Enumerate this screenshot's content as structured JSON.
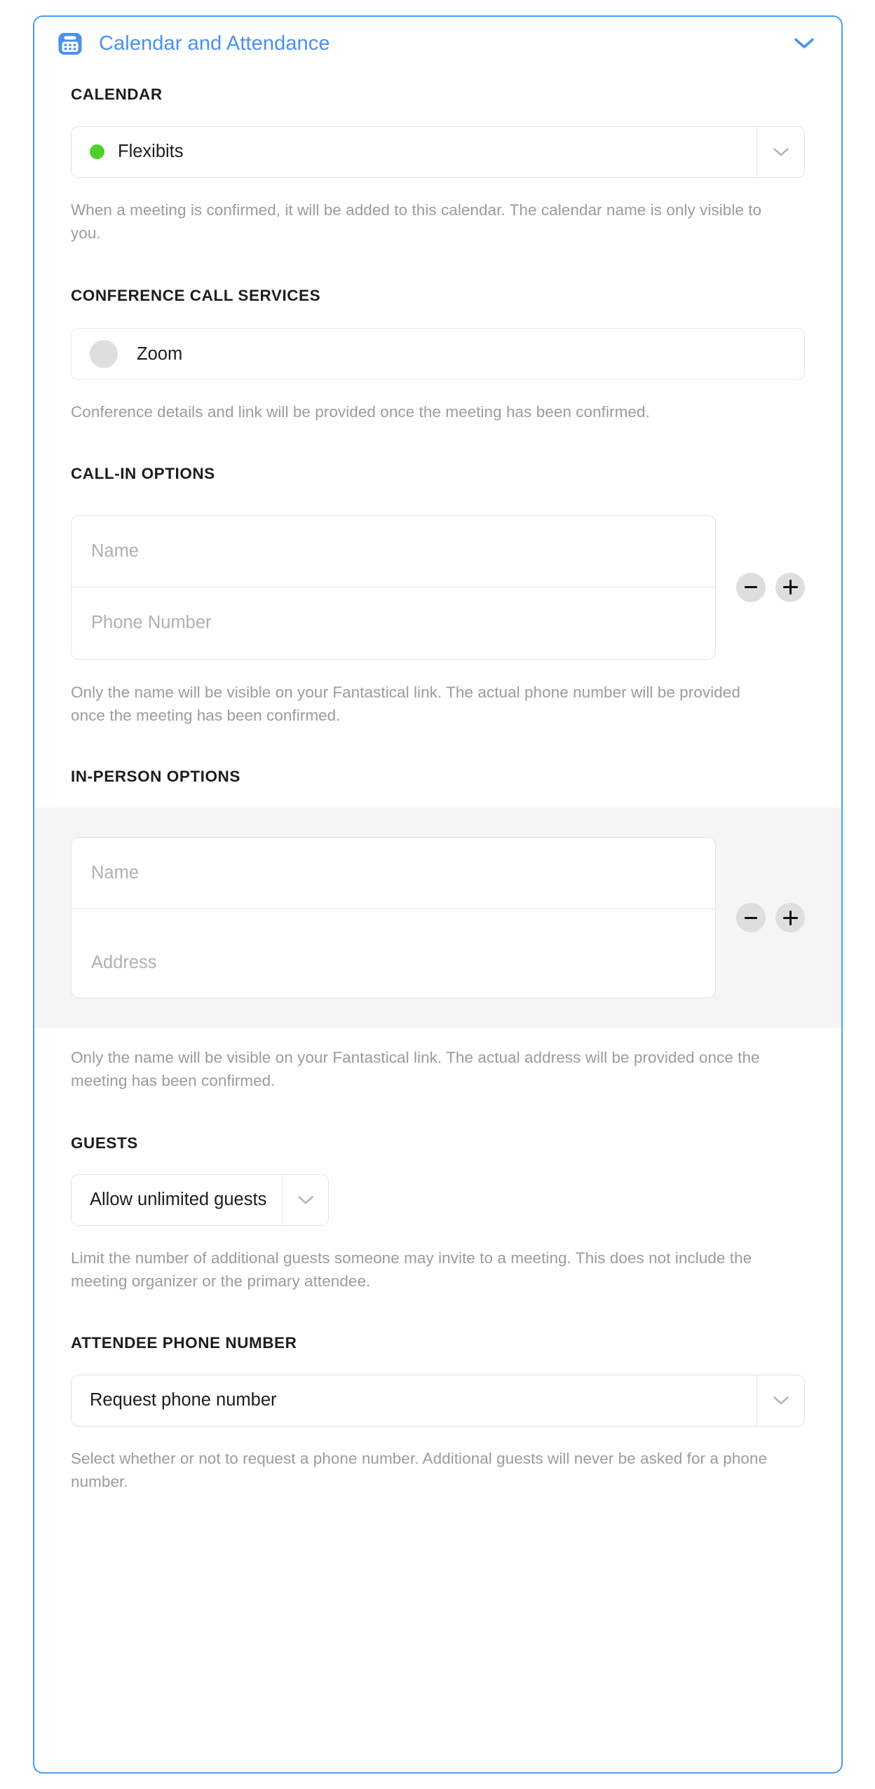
{
  "header": {
    "icon": "calendar-icon",
    "title": "Calendar and Attendance",
    "collapse_icon": "chevron-down-icon"
  },
  "colors": {
    "accent": "#4a9cf6",
    "title_blue": "#4a90f0",
    "calendar_dot_green": "#4ed02c",
    "avatar_gray": "#dedee1",
    "helper_gray": "#9b9ba1",
    "highlight_band": "#f5f5f6"
  },
  "sections": {
    "calendar": {
      "label": "CALENDAR",
      "select": {
        "value": "Flexibits",
        "dot_color": "#4ed02c",
        "arrow_icon": "chevron-down-icon"
      },
      "helper": "When a meeting is confirmed, it will be added to this calendar. The calendar name is only visible to you."
    },
    "conference_call_services": {
      "label": "CONFERENCE CALL SERVICES",
      "item": {
        "avatar_icon": "service-avatar-icon",
        "name": "Zoom"
      },
      "helper": "Conference details and link will be provided once the meeting has been confirmed."
    },
    "call_in_options": {
      "label": "CALL-IN OPTIONS",
      "name_placeholder": "Name",
      "name_value": "",
      "phone_placeholder": "Phone Number",
      "phone_value": "",
      "remove_icon": "minus-icon",
      "add_icon": "plus-icon",
      "helper": "Only the name will be visible on your Fantastical link. The actual phone number will be provided once the meeting has been confirmed."
    },
    "in_person_options": {
      "label": "IN-PERSON OPTIONS",
      "name_placeholder": "Name",
      "name_value": "",
      "address_placeholder": "Address",
      "address_value": "",
      "remove_icon": "minus-icon",
      "add_icon": "plus-icon",
      "helper": "Only the name will be visible on your Fantastical link. The actual address will be provided once the meeting has been confirmed."
    },
    "guests": {
      "label": "GUESTS",
      "select": {
        "value": "Allow unlimited guests",
        "arrow_icon": "chevron-down-icon"
      },
      "helper": "Limit the number of additional guests someone may invite to a meeting. This does not include the meeting organizer or the primary attendee."
    },
    "attendee_phone_number": {
      "label": "ATTENDEE PHONE NUMBER",
      "select": {
        "value": "Request phone number",
        "arrow_icon": "chevron-down-icon"
      },
      "helper": "Select whether or not to request a phone number. Additional guests will never be asked for a phone number."
    }
  }
}
